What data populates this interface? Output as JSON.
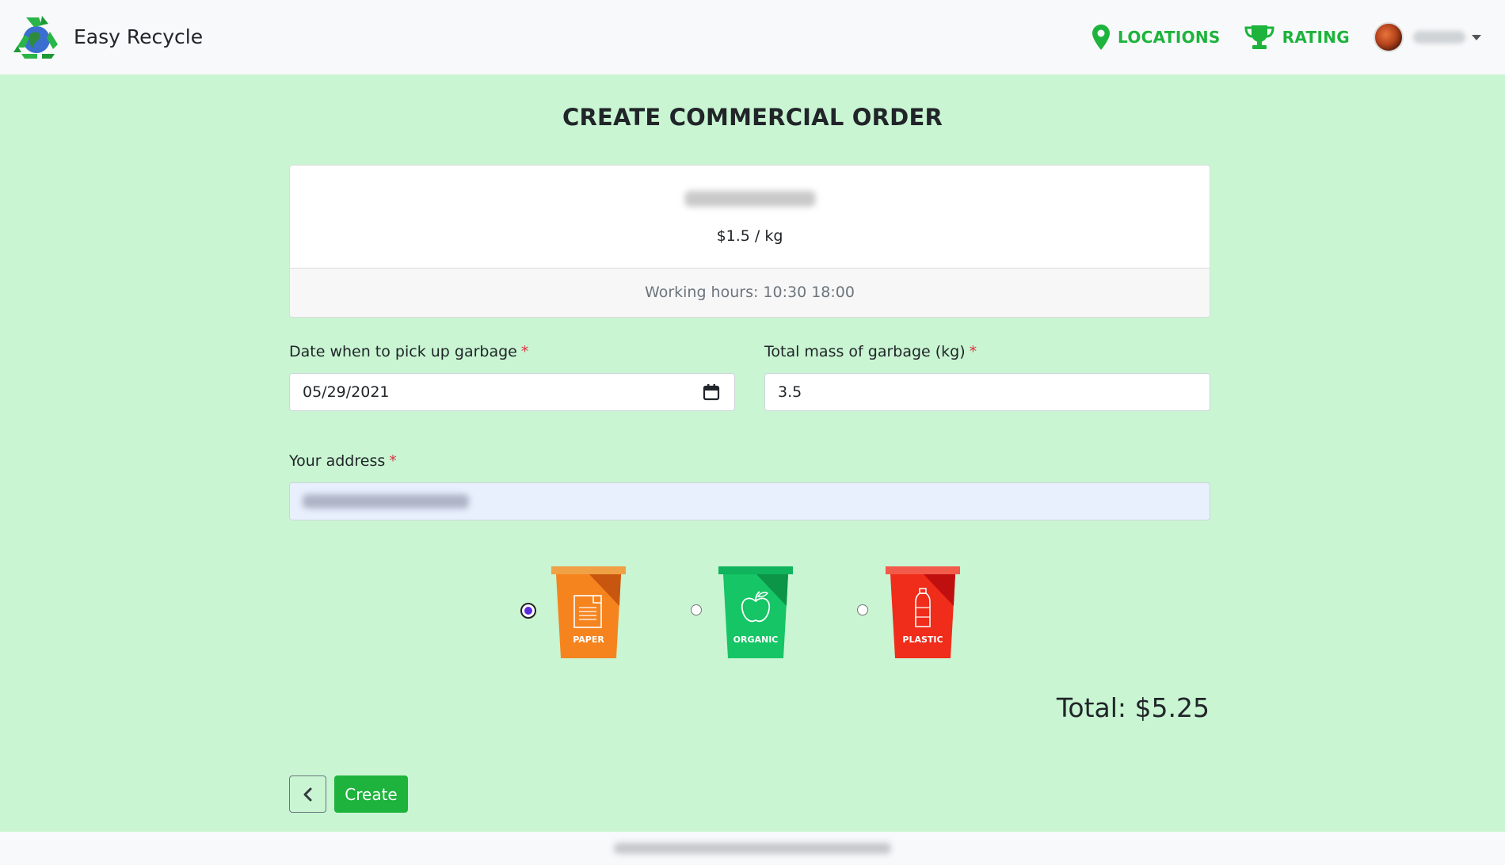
{
  "app": {
    "name": "Easy Recycle"
  },
  "nav": {
    "locations_label": "LOCATIONS",
    "rating_label": "RATING",
    "accent_color": "#1db33c"
  },
  "page": {
    "title": "CREATE COMMERCIAL ORDER"
  },
  "location_card": {
    "price": "$1.5 / kg",
    "working_hours": "Working hours: 10:30 18:00"
  },
  "form": {
    "date_label": "Date when to pick up garbage",
    "date_value": "05/29/2021",
    "mass_label": "Total mass of garbage (kg)",
    "mass_value": "3.5",
    "address_label": "Your address",
    "required_mark": "*"
  },
  "bins": [
    {
      "label": "PAPER",
      "color": "#f5841f",
      "selected": true
    },
    {
      "label": "ORGANIC",
      "color": "#16c565",
      "selected": false
    },
    {
      "label": "PLASTIC",
      "color": "#f02c1a",
      "selected": false
    }
  ],
  "total": "Total: $5.25",
  "actions": {
    "create_label": "Create"
  }
}
